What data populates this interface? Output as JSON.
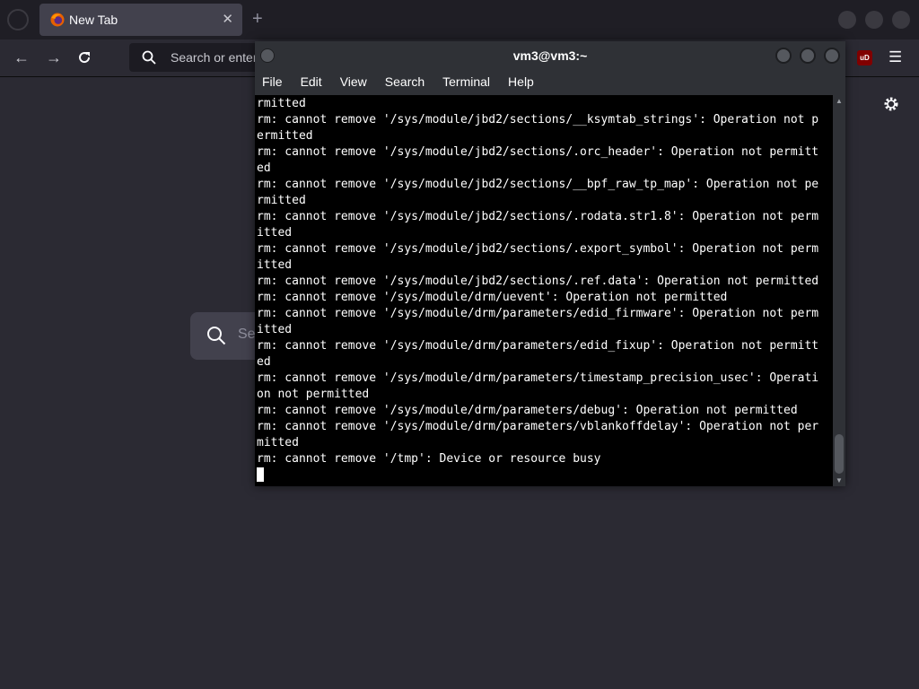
{
  "browser": {
    "tab": {
      "title": "New Tab"
    },
    "urlbar": {
      "placeholder": "Search or enter address"
    },
    "newtab_search": {
      "placeholder": "Se"
    },
    "extension": {
      "label": "uD"
    },
    "icons": [
      "firefox-view-icon",
      "firefox-logo-icon",
      "close-icon",
      "plus-icon",
      "back-arrow-icon",
      "forward-arrow-icon",
      "reload-icon",
      "search-icon",
      "ublock-origin-icon",
      "hamburger-menu-icon",
      "gear-icon"
    ]
  },
  "terminal": {
    "title": "vm3@vm3:~",
    "menu": [
      "File",
      "Edit",
      "View",
      "Search",
      "Terminal",
      "Help"
    ],
    "lines": [
      "rmitted",
      "rm: cannot remove '/sys/module/jbd2/sections/__ksymtab_strings': Operation not p",
      "ermitted",
      "rm: cannot remove '/sys/module/jbd2/sections/.orc_header': Operation not permitt",
      "ed",
      "rm: cannot remove '/sys/module/jbd2/sections/__bpf_raw_tp_map': Operation not pe",
      "rmitted",
      "rm: cannot remove '/sys/module/jbd2/sections/.rodata.str1.8': Operation not perm",
      "itted",
      "rm: cannot remove '/sys/module/jbd2/sections/.export_symbol': Operation not perm",
      "itted",
      "rm: cannot remove '/sys/module/jbd2/sections/.ref.data': Operation not permitted",
      "rm: cannot remove '/sys/module/drm/uevent': Operation not permitted",
      "rm: cannot remove '/sys/module/drm/parameters/edid_firmware': Operation not perm",
      "itted",
      "rm: cannot remove '/sys/module/drm/parameters/edid_fixup': Operation not permitt",
      "ed",
      "rm: cannot remove '/sys/module/drm/parameters/timestamp_precision_usec': Operati",
      "on not permitted",
      "rm: cannot remove '/sys/module/drm/parameters/debug': Operation not permitted",
      "rm: cannot remove '/sys/module/drm/parameters/vblankoffdelay': Operation not per",
      "mitted",
      "rm: cannot remove '/tmp': Device or resource busy"
    ]
  }
}
